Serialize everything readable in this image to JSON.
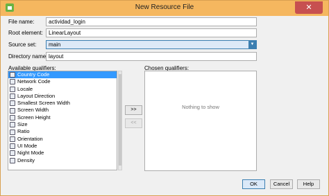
{
  "window": {
    "title": "New Resource File",
    "close_label": "✕"
  },
  "form": {
    "file_name_label": "File name:",
    "file_name_value": "actividad_login",
    "root_element_label": "Root element:",
    "root_element_value": "LinearLayout",
    "source_set_label": "Source set:",
    "source_set_value": "main",
    "directory_name_label": "Directory name:",
    "directory_name_value": "layout"
  },
  "qualifiers": {
    "available_label": "Available qualifiers:",
    "chosen_label": "Chosen qualifiers:",
    "empty_text": "Nothing to show",
    "items": [
      {
        "label": "Country Code",
        "icon": "globe-icon"
      },
      {
        "label": "Network Code",
        "icon": "network-icon"
      },
      {
        "label": "Locale",
        "icon": "globe-icon"
      },
      {
        "label": "Layout Direction",
        "icon": "layout-direction-icon"
      },
      {
        "label": "Smallest Screen Width",
        "icon": "screen-width-icon"
      },
      {
        "label": "Screen Width",
        "icon": "screen-width-icon"
      },
      {
        "label": "Screen Height",
        "icon": "screen-height-icon"
      },
      {
        "label": "Size",
        "icon": "size-icon"
      },
      {
        "label": "Ratio",
        "icon": "ratio-icon"
      },
      {
        "label": "Orientation",
        "icon": "orientation-icon"
      },
      {
        "label": "UI Mode",
        "icon": "ui-mode-icon"
      },
      {
        "label": "Night Mode",
        "icon": "night-mode-icon"
      },
      {
        "label": "Density",
        "icon": "density-icon"
      }
    ],
    "selected_index": 0,
    "add_label": ">>",
    "remove_label": "<<"
  },
  "buttons": {
    "ok": "OK",
    "cancel": "Cancel",
    "help": "Help"
  },
  "colors": {
    "titlebar": "#f5b75f",
    "selection": "#3399ff",
    "close": "#c75050"
  }
}
